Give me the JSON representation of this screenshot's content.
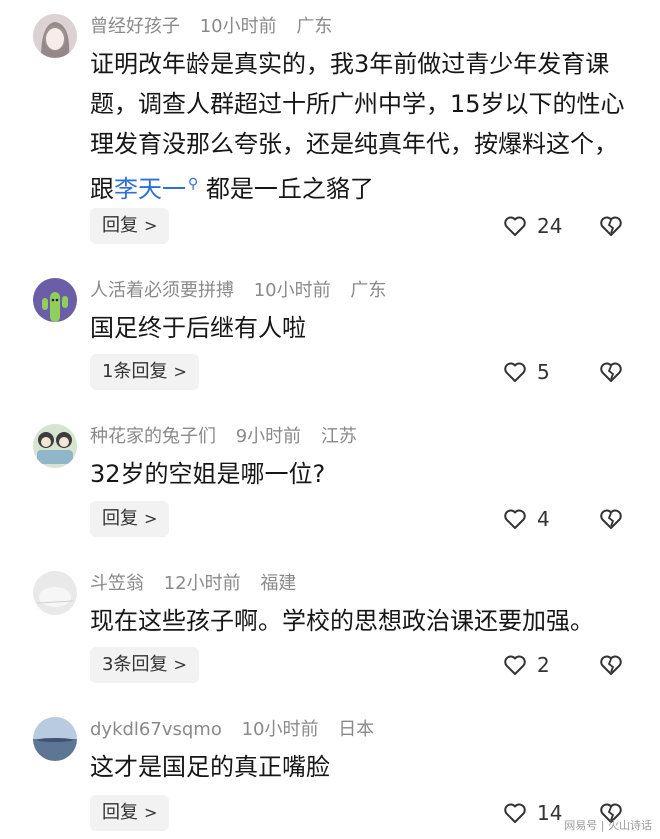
{
  "comments": [
    {
      "username": "曾经好孩子",
      "time": "10小时前",
      "location": "广东",
      "text_before": "证明改年龄是真实的，我3年前做过青少年发育课题，调查人群超过十所广州中学，15岁以下的性心理发育没那么夸张，还是纯真年代，按爆料这个，跟",
      "mention": "李天一",
      "text_after": "都是一丘之貉了",
      "reply_label": "回复",
      "likes": "24"
    },
    {
      "username": "人活着必须要拼搏",
      "time": "10小时前",
      "location": "广东",
      "text": "国足终于后继有人啦",
      "reply_label": "1条回复",
      "likes": "5"
    },
    {
      "username": "种花家的兔子们",
      "time": "9小时前",
      "location": "江苏",
      "text": "32岁的空姐是哪一位?",
      "reply_label": "回复",
      "likes": "4"
    },
    {
      "username": "斗笠翁",
      "time": "12小时前",
      "location": "福建",
      "text": "现在这些孩子啊。学校的思想政治课还要加强。",
      "reply_label": "3条回复",
      "likes": "2"
    },
    {
      "username": "dykdl67vsqmo",
      "time": "10小时前",
      "location": "日本",
      "text": "这才是国足的真正嘴脸",
      "reply_label": "回复",
      "likes": "14"
    }
  ],
  "watermark": "网易号 | 火山诗话"
}
